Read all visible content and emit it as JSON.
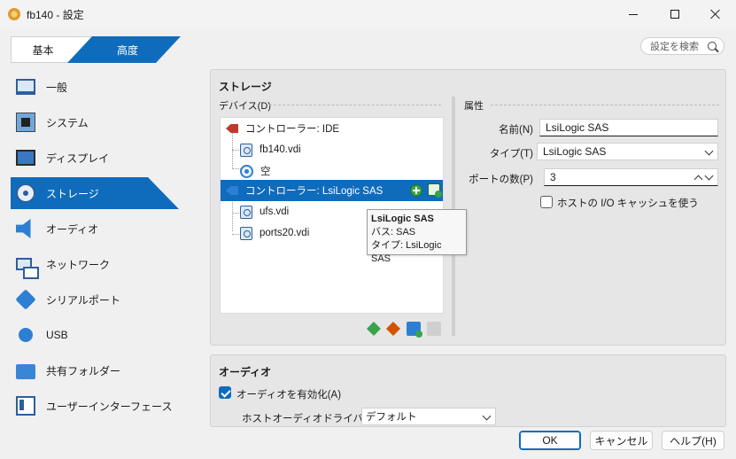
{
  "window": {
    "title": "fb140 - 設定"
  },
  "mode": {
    "basic": "基本",
    "advanced": "高度"
  },
  "search": {
    "placeholder": "設定を検索"
  },
  "sidebar": {
    "items": [
      {
        "label": "一般",
        "icon": "general-icon"
      },
      {
        "label": "システム",
        "icon": "system-icon"
      },
      {
        "label": "ディスプレイ",
        "icon": "display-icon"
      },
      {
        "label": "ストレージ",
        "icon": "storage-icon",
        "active": true
      },
      {
        "label": "オーディオ",
        "icon": "audio-icon"
      },
      {
        "label": "ネットワーク",
        "icon": "network-icon"
      },
      {
        "label": "シリアルポート",
        "icon": "serial-port-icon"
      },
      {
        "label": "USB",
        "icon": "usb-icon"
      },
      {
        "label": "共有フォルダー",
        "icon": "shared-folder-icon"
      },
      {
        "label": "ユーザーインターフェース",
        "icon": "user-interface-icon"
      }
    ]
  },
  "storage": {
    "title": "ストレージ",
    "devices_label": "デバイス(D)",
    "tree": [
      {
        "type": "controller",
        "label": "コントローラー: IDE"
      },
      {
        "type": "disk",
        "label": "fb140.vdi"
      },
      {
        "type": "optical",
        "label": "空"
      },
      {
        "type": "controller",
        "label": "コントローラー: LsiLogic SAS",
        "selected": true
      },
      {
        "type": "disk",
        "label": "ufs.vdi"
      },
      {
        "type": "disk",
        "label": "ports20.vdi"
      }
    ],
    "tooltip": {
      "title": "LsiLogic SAS",
      "bus": "バス:  SAS",
      "type": "タイプ:  LsiLogic SAS"
    },
    "attributes": {
      "title": "属性",
      "name_label": "名前(N)",
      "name_value": "LsiLogic SAS",
      "type_label": "タイプ(T)",
      "type_value": "LsiLogic SAS",
      "ports_label": "ポートの数(P)",
      "ports_value": "3",
      "host_cache_label": "ホストの I/O キャッシュを使う",
      "host_cache_checked": false
    }
  },
  "audio": {
    "title": "オーディオ",
    "enable_label": "オーディオを有効化(A)",
    "enable_checked": true,
    "driver_label": "ホストオーディオドライバー(D)",
    "driver_value": "デフォルト"
  },
  "buttons": {
    "ok": "OK",
    "cancel": "キャンセル",
    "help": "ヘルプ(H)"
  },
  "colors": {
    "accent": "#0f6cbd",
    "panel": "#e6e6e6"
  }
}
